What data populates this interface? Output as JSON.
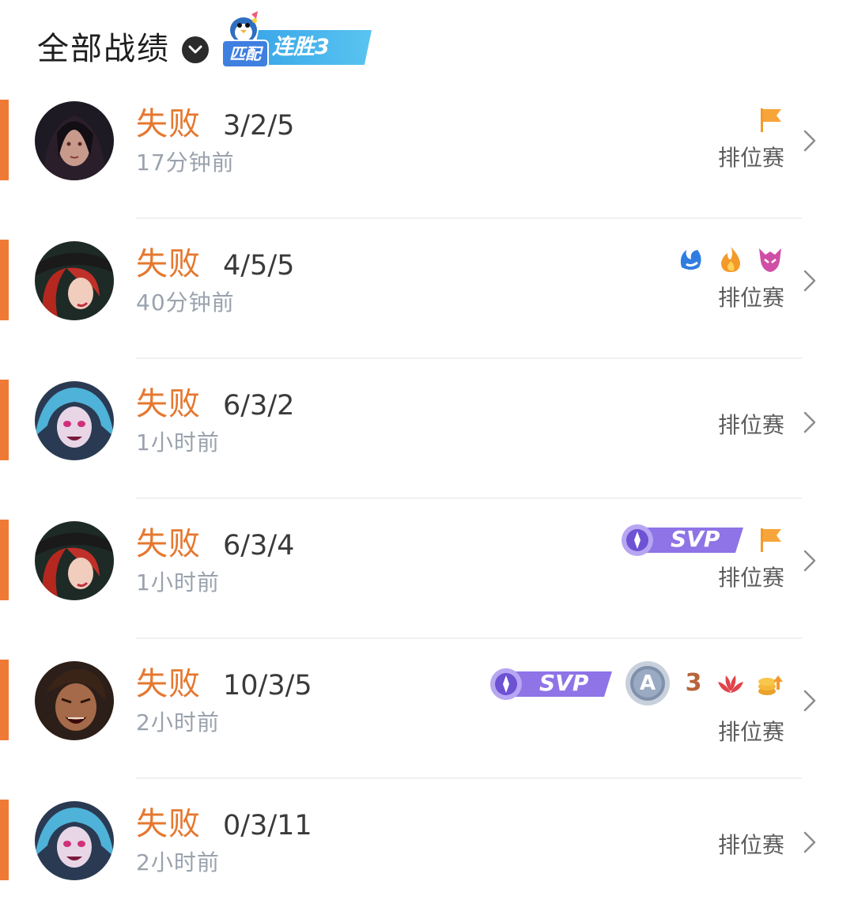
{
  "header": {
    "title": "全部战绩",
    "streak_mode": "匹配",
    "streak_label": "连胜3"
  },
  "colors": {
    "accent_orange": "#e5782f",
    "loss_bar": "#ef7a36",
    "muted_text": "#9aa2ad",
    "svp_purple": "#8a6fe0",
    "streak_blue": "#3aa6e8"
  },
  "matches": [
    {
      "result": "失败",
      "kda": "3/2/5",
      "time": "17分钟前",
      "mode": "排位赛",
      "champion_avatar": "dark-haired-champion-portrait",
      "badges": [
        "orange-flag-icon"
      ]
    },
    {
      "result": "失败",
      "kda": "4/5/5",
      "time": "40分钟前",
      "mode": "排位赛",
      "champion_avatar": "red-haired-gunslinger-portrait",
      "badges": [
        "blue-water-icon",
        "orange-flame-icon",
        "pink-demon-icon"
      ]
    },
    {
      "result": "失败",
      "kda": "6/3/2",
      "time": "1小时前",
      "mode": "排位赛",
      "champion_avatar": "blue-haired-champion-portrait",
      "badges": []
    },
    {
      "result": "失败",
      "kda": "6/3/4",
      "time": "1小时前",
      "mode": "排位赛",
      "champion_avatar": "red-haired-gunslinger-portrait",
      "badges": [
        "svp-badge",
        "orange-flag-icon"
      ],
      "svp_label": "SVP"
    },
    {
      "result": "失败",
      "kda": "10/3/5",
      "time": "2小时前",
      "mode": "排位赛",
      "champion_avatar": "axe-warrior-portrait",
      "badges": [
        "svp-badge",
        "grade-a-badge",
        "triple-kill-icon",
        "red-lotus-icon",
        "gold-coins-icon"
      ],
      "svp_label": "SVP",
      "grade_label": "A",
      "triple_label": "3"
    },
    {
      "result": "失败",
      "kda": "0/3/11",
      "time": "2小时前",
      "mode": "排位赛",
      "champion_avatar": "blue-haired-champion-portrait",
      "badges": []
    }
  ]
}
